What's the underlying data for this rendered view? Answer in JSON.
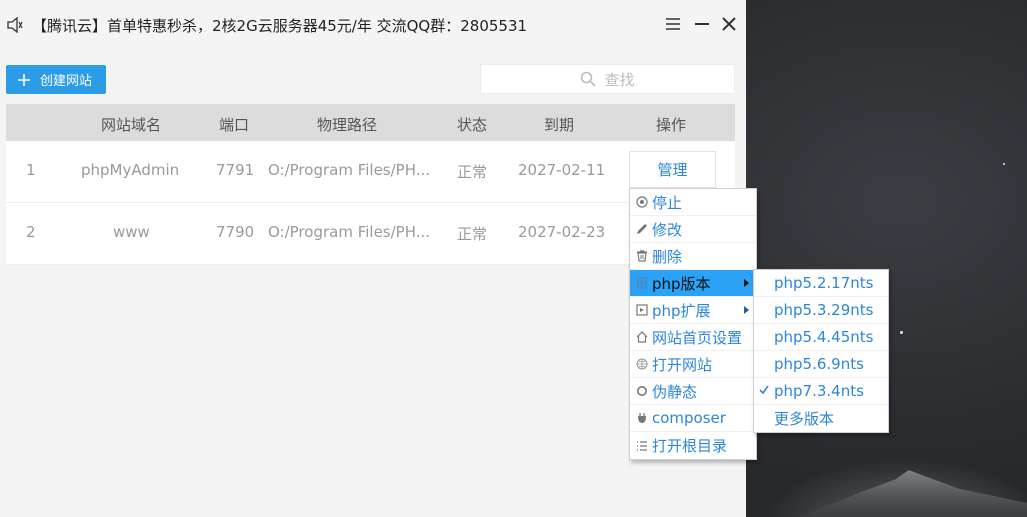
{
  "window": {
    "title": "【腾讯云】首单特惠秒杀，2核2G云服务器45元/年 交流QQ群：2805531",
    "icons": [
      "speaker-icon",
      "menu-icon",
      "minimize-icon",
      "close-icon"
    ]
  },
  "toolbar": {
    "create_label": "创建网站",
    "search_placeholder": "查找"
  },
  "table": {
    "headers": [
      "网站域名",
      "端口",
      "物理路径",
      "状态",
      "到期",
      "操作"
    ],
    "rows": [
      {
        "index": "1",
        "domain": "phpMyAdmin",
        "port": "7791",
        "path": "O:/Program Files/PH...",
        "status": "正常",
        "expiry": "2027-02-11",
        "action": "管理"
      },
      {
        "index": "2",
        "domain": "www",
        "port": "7790",
        "path": "O:/Program Files/PH...",
        "status": "正常",
        "expiry": "2027-02-23"
      }
    ]
  },
  "context_menu": {
    "items": [
      {
        "label": "停止",
        "icon": "stop-icon"
      },
      {
        "label": "修改",
        "icon": "pencil-icon"
      },
      {
        "label": "删除",
        "icon": "trash-icon"
      },
      {
        "label": "php版本",
        "icon": "php-icon",
        "submenu": true,
        "active": true
      },
      {
        "label": "php扩展",
        "icon": "extension-icon",
        "submenu": true
      },
      {
        "label": "网站首页设置",
        "icon": "home-icon"
      },
      {
        "label": "打开网站",
        "icon": "globe-icon"
      },
      {
        "label": "伪静态",
        "icon": "refresh-icon"
      },
      {
        "label": "composer",
        "icon": "composer-icon"
      },
      {
        "label": "打开根目录",
        "icon": "list-icon"
      }
    ]
  },
  "php_versions": {
    "items": [
      {
        "label": "php5.2.17nts",
        "checked": false
      },
      {
        "label": "php5.3.29nts",
        "checked": false
      },
      {
        "label": "php5.4.45nts",
        "checked": false
      },
      {
        "label": "php5.6.9nts",
        "checked": false
      },
      {
        "label": "php7.3.4nts",
        "checked": true
      },
      {
        "label": "更多版本",
        "checked": false
      }
    ]
  },
  "colors": {
    "accent": "#2d9ce6",
    "link": "#2d86d8",
    "menu_highlight": "#2aa2f5"
  }
}
